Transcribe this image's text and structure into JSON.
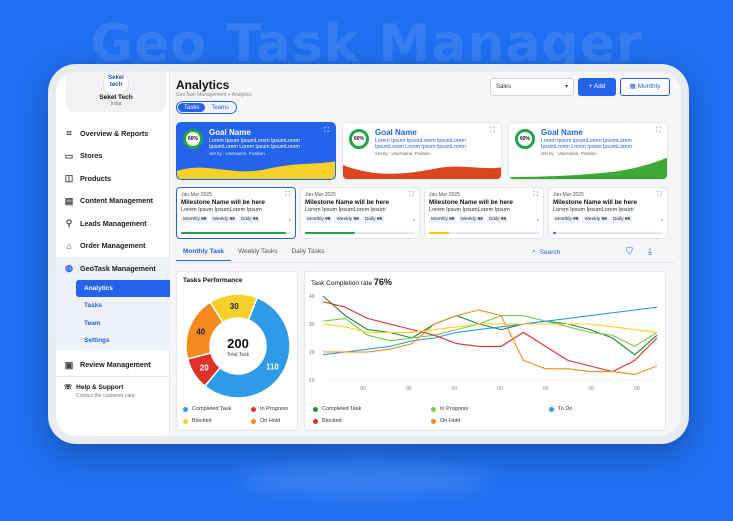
{
  "bg_title": "Geo Task Manager",
  "sidebar": {
    "brand": {
      "logo": "Sekel\ntech",
      "name": "Sekel Tech",
      "sub": "India"
    },
    "items": [
      {
        "label": "Overview & Reports",
        "icon": "grid-icon"
      },
      {
        "label": "Stores",
        "icon": "store-icon"
      },
      {
        "label": "Products",
        "icon": "box-icon"
      },
      {
        "label": "Content Management",
        "icon": "content-icon"
      },
      {
        "label": "Leads Management",
        "icon": "leads-icon"
      },
      {
        "label": "Order Management",
        "icon": "order-icon"
      }
    ],
    "group": {
      "label": "GeoTask Management",
      "subs": [
        "Analytics",
        "Tasks",
        "Team",
        "Settings"
      ]
    },
    "review": "Review Management",
    "help_title": "Help & Support",
    "help_sub": "Contact the customer care"
  },
  "header": {
    "title": "Analytics",
    "breadcrumb": "GeoTask Management > Analytics",
    "segments": [
      "Tasks",
      "Teams"
    ],
    "select_value": "Sales",
    "add_label": "Add",
    "month_label": "Monthly"
  },
  "goals": [
    {
      "pct": "60%",
      "name": "Goal Name",
      "desc": "Lorem Ipsum IpsumLorem IpsumLorem IpsumLorem Lorem Ipsum IpsumLorem",
      "set_by": "Set by : Username, Position",
      "theme": "blue"
    },
    {
      "pct": "60%",
      "name": "Goal Name",
      "desc": "Lorem Ipsum IpsumLorem IpsumLorem IpsumLorem Lorem Ipsum IpsumLorem",
      "set_by": "Set by : Username, Position",
      "theme": "orange"
    },
    {
      "pct": "60%",
      "name": "Goal Name",
      "desc": "Lorem Ipsum IpsumLorem IpsumLorem IpsumLorem Lorem Ipsum IpsumLorem",
      "set_by": "Set by : Username, Position",
      "theme": "green"
    }
  ],
  "milestones": [
    {
      "date": "Jan-Mar 2025",
      "name": "Milestone Name will be here",
      "desc": "Lorem Ipsum IpsumLorem Ipsum",
      "monthly": "99",
      "weekly": "99",
      "daily": "99",
      "progress": 0.95,
      "color": "#22a34a"
    },
    {
      "date": "Jan-Mar 2025",
      "name": "Milestone Name will be here",
      "desc": "Lorem Ipsum IpsumLorem Ipsum",
      "monthly": "99",
      "weekly": "99",
      "daily": "99",
      "progress": 0.45,
      "color": "#22a34a"
    },
    {
      "date": "Jan-Mar 2025",
      "name": "Milestone Name will be here",
      "desc": "Lorem Ipsum IpsumLorem Ipsum",
      "monthly": "99",
      "weekly": "99",
      "daily": "99",
      "progress": 0.18,
      "color": "#f5c518"
    },
    {
      "date": "Jan-Mar 2025",
      "name": "Milestone Name will be here",
      "desc": "Lorem Ipsum IpsumLorem Ipsum",
      "monthly": "99",
      "weekly": "99",
      "daily": "99",
      "progress": 0.03,
      "color": "#e0302a"
    }
  ],
  "chip_labels": {
    "monthly": "Monthly",
    "weekly": "Weekly",
    "daily": "Daily"
  },
  "tabs": [
    "Monthly Task",
    "Weekly Tasks",
    "Daily Tasks"
  ],
  "search_label": "Search",
  "colors": {
    "accent": "#2563eb",
    "completed": "#2f9be8",
    "in_progress": "#e0302a",
    "blocked": "#f5d028",
    "on_hold": "#f58a1f"
  },
  "chart_data": [
    {
      "type": "pie",
      "title": "Tasks Performance",
      "center_value": "200",
      "center_label": "Total Task",
      "slices": [
        {
          "name": "Completed Task",
          "value": 110,
          "color": "#2f9be8"
        },
        {
          "name": "In Progress",
          "value": 20,
          "color": "#e0302a"
        },
        {
          "name": "On Hold",
          "value": 40,
          "color": "#f58a1f"
        },
        {
          "name": "Blocked",
          "value": 30,
          "color": "#f5d028"
        }
      ],
      "legend": [
        "Completed Task",
        "In Progress",
        "Blocked",
        "On Hold"
      ]
    },
    {
      "type": "line",
      "title": "Task Completion rate",
      "headline": "76%",
      "yticks": [
        10,
        20,
        30,
        40
      ],
      "ylim": [
        10,
        40
      ],
      "x": [
        0,
        1,
        2,
        3,
        4,
        5,
        6,
        7,
        8,
        9,
        10,
        11,
        12,
        13,
        14,
        15
      ],
      "xtick_labels": [
        "00",
        "00",
        "00",
        "00",
        "00",
        "00",
        "00"
      ],
      "series": [
        {
          "name": "Completed Task",
          "color": "#1f8a3a",
          "values": [
            40,
            33,
            28,
            27,
            25,
            30,
            33,
            30,
            28,
            30,
            31,
            30,
            28,
            25,
            19,
            26
          ]
        },
        {
          "name": "In Progress",
          "color": "#7bc84c",
          "values": [
            31,
            32,
            26,
            24,
            25,
            26,
            28,
            30,
            33,
            33,
            31,
            29,
            27,
            26,
            22,
            27
          ]
        },
        {
          "name": "To Do",
          "color": "#2f9be8",
          "values": [
            19,
            20,
            21,
            22,
            24,
            25,
            27,
            28,
            29,
            30,
            31,
            32,
            33,
            34,
            35,
            36
          ]
        },
        {
          "name": "Blocked",
          "color": "#e0302a",
          "values": [
            38,
            36,
            32,
            30,
            28,
            26,
            23,
            22,
            22,
            27,
            22,
            17,
            15,
            13,
            17,
            25
          ]
        },
        {
          "name": "On Hold",
          "color": "#f58a1f",
          "values": [
            20,
            20,
            20,
            21,
            23,
            30,
            33,
            35,
            33,
            17,
            14,
            14,
            13,
            13,
            12,
            15
          ]
        },
        {
          "name": "Yellow",
          "color": "#f5d028",
          "values": [
            30,
            29,
            27,
            27,
            27,
            28,
            29,
            30,
            30,
            30,
            30,
            30,
            30,
            29,
            28,
            27
          ]
        }
      ],
      "legend": [
        "Completed Task",
        "In Progress",
        "To Do",
        "Blocked",
        "On Hold"
      ]
    }
  ]
}
